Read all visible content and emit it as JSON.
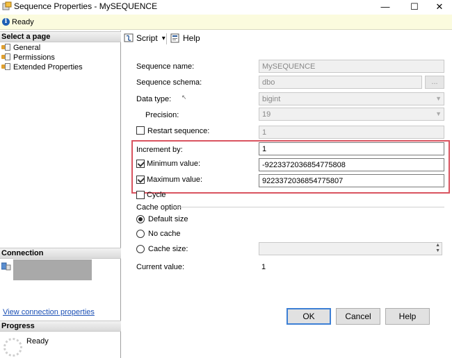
{
  "window": {
    "title": "Sequence Properties - MySEQUENCE",
    "min_glyph": "—",
    "max_glyph": "☐",
    "close_glyph": "✕"
  },
  "status": {
    "text": "Ready",
    "icon": "info-icon",
    "bg_color": "#fbfbde"
  },
  "left": {
    "select_page_header": "Select a page",
    "pages": [
      {
        "label": "General",
        "icon": "wrench-icon"
      },
      {
        "label": "Permissions",
        "icon": "wrench-icon"
      },
      {
        "label": "Extended Properties",
        "icon": "wrench-icon"
      }
    ],
    "connection_header": "Connection",
    "connection_link": "View connection properties",
    "progress_header": "Progress",
    "progress_text": "Ready"
  },
  "toolbar": {
    "script_label": "Script",
    "script_dropdown": "▾",
    "help_label": "Help"
  },
  "form": {
    "sequence_name": {
      "label": "Sequence name:",
      "value": "MySEQUENCE"
    },
    "sequence_schema": {
      "label": "Sequence schema:",
      "value": "dbo",
      "browse": "..."
    },
    "data_type": {
      "label": "Data type:",
      "value": "bigint"
    },
    "precision": {
      "label": "Precision:",
      "value": "19"
    },
    "restart_sequence": {
      "label": "Restart sequence:",
      "value": "1",
      "checked": false
    },
    "increment_by": {
      "label": "Increment by:",
      "value": "1"
    },
    "minimum_value": {
      "label": "Minimum value:",
      "value": "-9223372036854775808",
      "checked": true
    },
    "maximum_value": {
      "label": "Maximum value:",
      "value": "9223372036854775807",
      "checked": true
    },
    "cycle": {
      "label": "Cycle",
      "checked": false
    },
    "cache_option": {
      "label": "Cache option",
      "default_size": "Default size",
      "no_cache": "No cache",
      "cache_size": "Cache size:",
      "selected": "Default size"
    },
    "current_value": {
      "label": "Current value:",
      "value": "1"
    }
  },
  "buttons": {
    "ok": "OK",
    "cancel": "Cancel",
    "help": "Help"
  },
  "colors": {
    "highlight": "#d9535f",
    "link": "#1a4fb5",
    "default_button_border": "#3c7fd5"
  }
}
